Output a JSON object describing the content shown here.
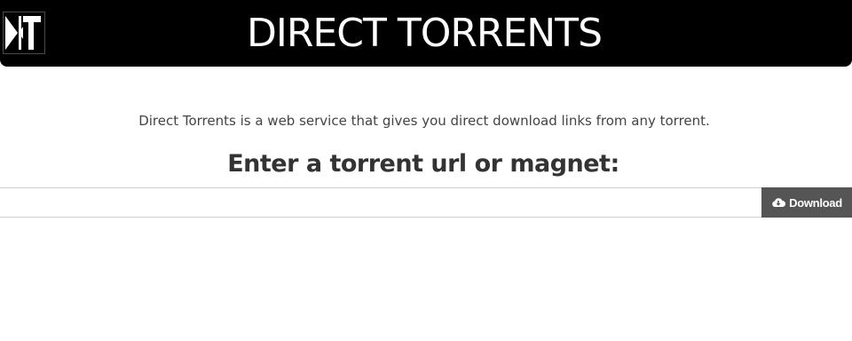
{
  "header": {
    "title": "DIRECT TORRENTS",
    "logo_icon": "dt-logo-icon",
    "background": "#000000"
  },
  "main": {
    "tagline": "Direct Torrents is a web service that gives you direct download links from any torrent.",
    "prompt": "Enter a torrent url or magnet:",
    "input": {
      "value": "",
      "placeholder": ""
    },
    "download_button": {
      "label": "Download",
      "icon": "cloud-download-icon",
      "background": "#555555"
    }
  }
}
